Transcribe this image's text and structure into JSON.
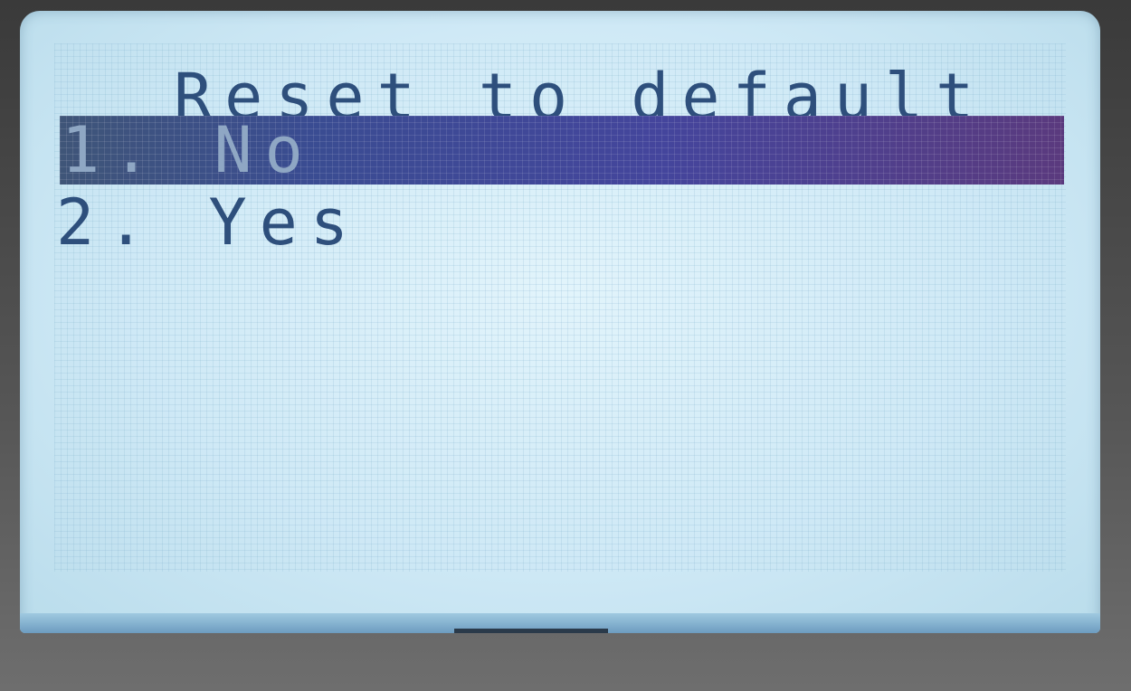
{
  "title": "Reset to default",
  "menu": {
    "items": [
      {
        "number": "1.",
        "label": "No",
        "selected": true
      },
      {
        "number": "2.",
        "label": "Yes",
        "selected": false
      }
    ]
  },
  "colors": {
    "lcd_background": "#cfe9f6",
    "text": "#2e4f7c",
    "highlight": "#3a4c92"
  }
}
